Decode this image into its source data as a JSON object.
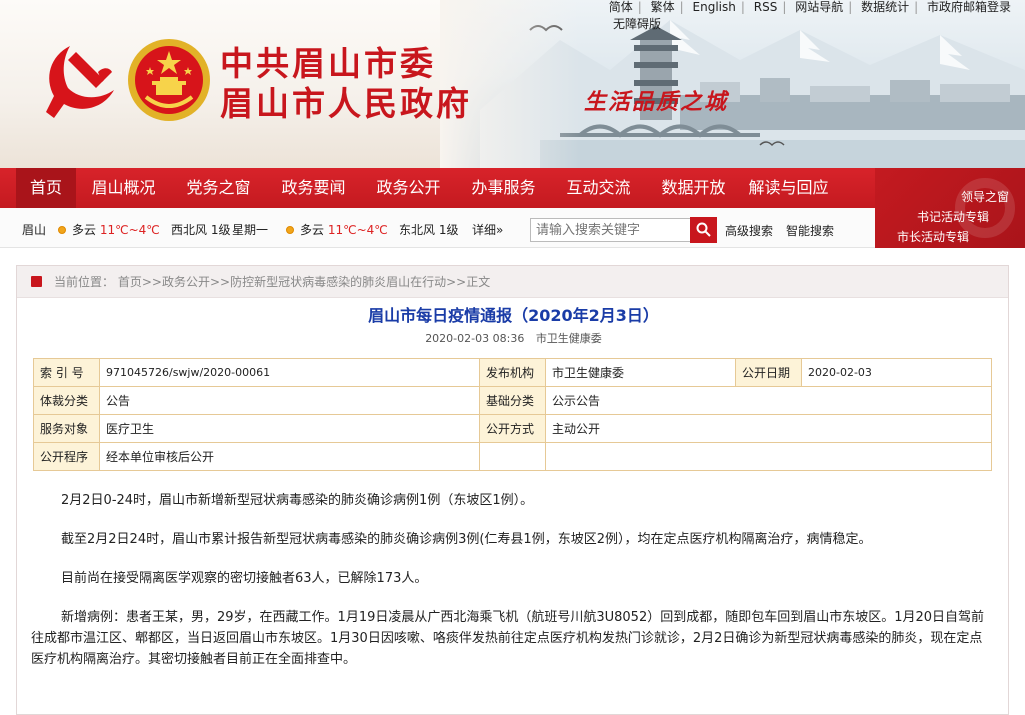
{
  "header": {
    "top_links": [
      "简体",
      "繁体",
      "English",
      "RSS",
      "网站导航",
      "数据统计",
      "市政府邮箱登录"
    ],
    "accessibility": "无障碍版",
    "title_line1": "中共眉山市委",
    "title_line2": "眉山市人民政府",
    "slogan": "生活品质之城"
  },
  "nav": {
    "items": [
      "首页",
      "眉山概况",
      "党务之窗",
      "政务要闻",
      "政务公开",
      "办事服务",
      "互动交流",
      "数据开放",
      "解读与回应"
    ],
    "active_index": 0
  },
  "leader_links": [
    "领导之窗",
    "书记活动专辑",
    "市长活动专辑"
  ],
  "weather": {
    "city": "眉山",
    "today": {
      "condition": "多云",
      "high": "11℃",
      "low": "4℃",
      "wind": "西北风 1级"
    },
    "tomorrow_label": "星期一",
    "tomorrow": {
      "condition": "多云",
      "high": "11℃",
      "low": "4℃",
      "wind": "东北风 1级"
    },
    "detail_link": "详细»"
  },
  "search": {
    "placeholder": "请输入搜索关键字",
    "advanced": "高级搜索",
    "smart": "智能搜索"
  },
  "breadcrumb": {
    "prefix": "当前位置：",
    "items": [
      "首页",
      "政务公开",
      "防控新型冠状病毒感染的肺炎眉山在行动",
      "正文"
    ],
    "separator": ">>"
  },
  "article": {
    "title": "眉山市每日疫情通报（2020年2月3日）",
    "datetime": "2020-02-03 08:36",
    "source": "市卫生健康委",
    "meta": {
      "index_label": "索 引 号",
      "index_value": "971045726/swjw/2020-00061",
      "publisher_label": "发布机构",
      "publisher_value": "市卫生健康委",
      "date_label": "公开日期",
      "date_value": "2020-02-03",
      "genre_label": "体裁分类",
      "genre_value": "公告",
      "basic_label": "基础分类",
      "basic_value": "公示公告",
      "target_label": "服务对象",
      "target_value": "医疗卫生",
      "mode_label": "公开方式",
      "mode_value": "主动公开",
      "procedure_label": "公开程序",
      "procedure_value": "经本单位审核后公开"
    },
    "paragraphs": [
      "2月2日0-24时，眉山市新增新型冠状病毒感染的肺炎确诊病例1例（东坡区1例）。",
      "截至2月2日24时，眉山市累计报告新型冠状病毒感染的肺炎确诊病例3例(仁寿县1例，东坡区2例），均在定点医疗机构隔离治疗，病情稳定。",
      "目前尚在接受隔离医学观察的密切接触者63人，已解除173人。",
      "新增病例：患者王某，男，29岁，在西藏工作。1月19日凌晨从广西北海乘飞机（航班号川航3U8052）回到成都，随即包车回到眉山市东坡区。1月20日自驾前往成都市温江区、郫都区，当日返回眉山市东坡区。1月30日因咳嗽、咯痰伴发热前往定点医疗机构发热门诊就诊，2月2日确诊为新型冠状病毒感染的肺炎，现在定点医疗机构隔离治疗。其密切接触者目前正在全面排查中。"
    ]
  },
  "colors": {
    "brand_red": "#c8161d",
    "title_blue": "#1a3ca7",
    "table_label_bg": "#fdf3d8"
  }
}
